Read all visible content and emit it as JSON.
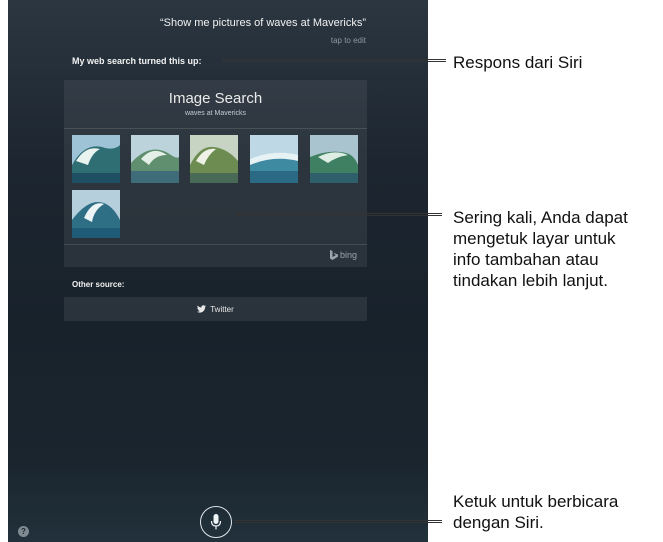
{
  "siri": {
    "query": "“Show me pictures of waves at Mavericks”",
    "tap_to_edit": "tap to edit",
    "response_heading": "My web search turned this up:"
  },
  "image_search": {
    "title": "Image Search",
    "subtitle": "waves at Mavericks",
    "thumbnail_count": 6,
    "provider": "bing"
  },
  "other_source": {
    "label": "Other source:",
    "twitter_label": "Twitter"
  },
  "controls": {
    "mic": "microphone-icon",
    "help": "?"
  },
  "callouts": {
    "response": "Respons dari Siri",
    "tap_info": [
      "Sering kali, Anda dapat",
      "mengetuk layar untuk",
      "info tambahan atau",
      "tindakan lebih lanjut."
    ],
    "speak": [
      "Ketuk untuk berbicara",
      "dengan Siri."
    ]
  },
  "colors": {
    "screen_bg": "#1d2630",
    "text_light": "#f2f2f2",
    "callout_text": "#111111"
  }
}
